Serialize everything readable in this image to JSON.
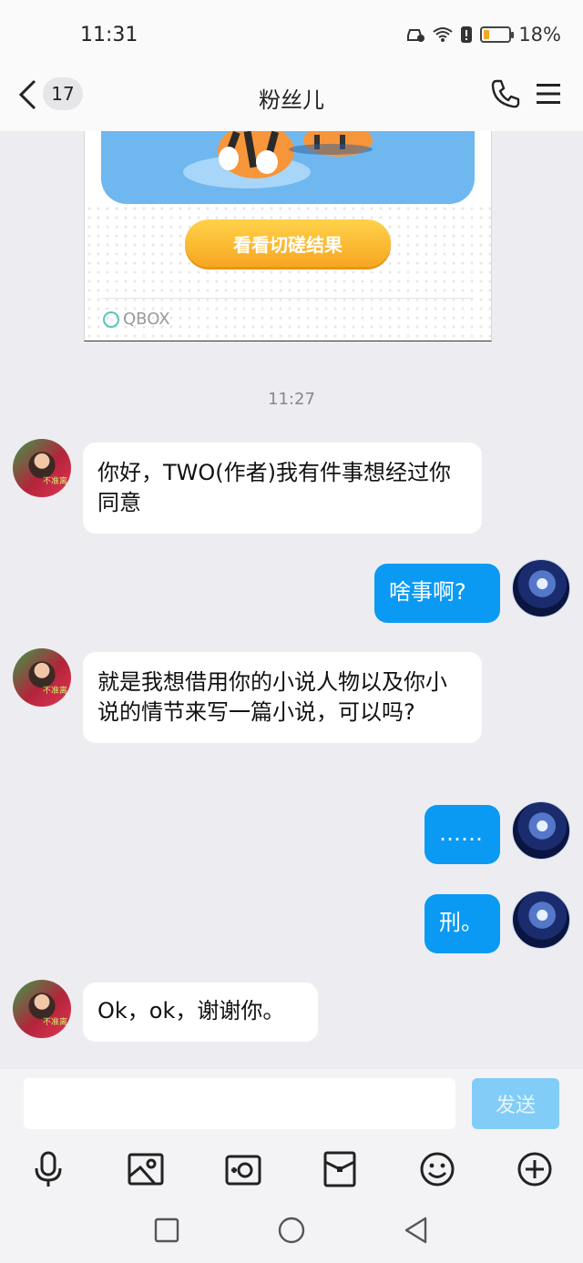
{
  "status": {
    "time": "11:31",
    "battery_text": "18%",
    "battery_level": 0.18
  },
  "header": {
    "back_count": "17",
    "title": "粉丝儿"
  },
  "card": {
    "button_label": "看看切磋结果",
    "source_label": "QBOX"
  },
  "timestamp": "11:27",
  "messages": [
    {
      "side": "in",
      "text": "你好，TWO(作者)我有件事想经过你同意",
      "avatar_tag": "不准离"
    },
    {
      "side": "out",
      "text": "啥事啊?"
    },
    {
      "side": "in",
      "text": "就是我想借用你的小说人物以及你小说的情节来写一篇小说，可以吗?",
      "avatar_tag": "不准离"
    },
    {
      "side": "out",
      "text": "……"
    },
    {
      "side": "out",
      "text": "刑。"
    },
    {
      "side": "in",
      "text": "Ok，ok，谢谢你。",
      "avatar_tag": "不准离"
    }
  ],
  "composer": {
    "send_label": "发送"
  },
  "colors": {
    "outgoing_bubble": "#0a9af3",
    "incoming_bubble": "#ffffff",
    "background": "#ededf1",
    "send_button": "#82cdf7"
  },
  "toolbar_icons": [
    "microphone-icon",
    "image-icon",
    "camera-icon",
    "red-packet-icon",
    "emoji-icon",
    "plus-icon"
  ],
  "nav_icons": [
    "recents-icon",
    "home-icon",
    "back-icon"
  ]
}
